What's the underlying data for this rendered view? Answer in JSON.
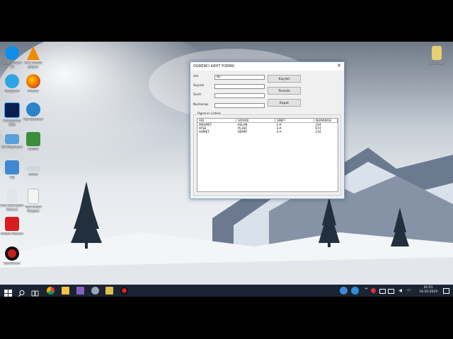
{
  "desktop_icons": [
    {
      "label": "TeamViewer 14",
      "icon": "teamviewer-icon",
      "color": "#0e8ee9"
    },
    {
      "label": "VLC media player",
      "icon": "vlc-icon",
      "color": "#f08a00"
    },
    {
      "label": "Telegram",
      "icon": "telegram-icon",
      "color": "#2ca5e0"
    },
    {
      "label": "Firefox",
      "icon": "firefox-icon",
      "color": "#e66000"
    },
    {
      "label": "Photoshop CS6",
      "icon": "photoshop-icon",
      "color": "#0c1e4d"
    },
    {
      "label": "HD Sentinel",
      "icon": "hd-sentinel-icon",
      "color": "#2a82c9"
    },
    {
      "label": "Bu bilgisayar",
      "icon": "computer-icon",
      "color": "#5aa0d8"
    },
    {
      "label": "Kodlar",
      "icon": "folder-icon",
      "color": "#3a8d3a"
    },
    {
      "label": "Ağ",
      "icon": "network-icon",
      "color": "#3f89d1"
    },
    {
      "label": "abcdl",
      "icon": "drive-icon",
      "color": "#cfd6de"
    },
    {
      "label": "Geri Dönüşüm Kutusu",
      "icon": "recycle-bin-icon",
      "color": "#dfe5ea"
    },
    {
      "label": "Yeni Metin Belgesi",
      "icon": "text-document-icon",
      "color": "#f4f4f4"
    },
    {
      "label": "Adobe Reader",
      "icon": "pdf-icon",
      "color": "#d71e1e"
    },
    {
      "label": "Bandicam",
      "icon": "bandicam-icon",
      "color": "#c91f1f"
    },
    {
      "label": "youtube",
      "icon": "youtube-folder-icon",
      "color": "#e8d070"
    }
  ],
  "dialog": {
    "title": "OGRENCI KAYIT FORMU",
    "close": "✕",
    "fields": [
      {
        "label": "Adı",
        "value": "Ali",
        "name": "name"
      },
      {
        "label": "Soyadı",
        "value": "",
        "name": "surname"
      },
      {
        "label": "Sınıfı",
        "value": "",
        "name": "class"
      },
      {
        "label": "Numarası",
        "value": "",
        "name": "number"
      }
    ],
    "buttons": {
      "save": "Kaydet",
      "clear": "Temizle",
      "close": "Kapat"
    },
    "group_label": "Ogrenci Listesi",
    "list": {
      "columns": [
        "ADI",
        "SOYADI",
        "SINIFI",
        "NUMARASI"
      ],
      "rows": [
        [
          "MEHMET",
          "ASLAN",
          "1-A",
          "234"
        ],
        [
          "AYŞE",
          "YILDIZ",
          "3-A",
          "674"
        ],
        [
          "AHMET",
          "DEMİR",
          "3-A",
          "234"
        ]
      ]
    }
  },
  "taskbar": {
    "time": "01:51",
    "date": "16.10.2019"
  },
  "colors": {
    "taskbar": "#1b2433",
    "dialog_border": "#7aa4d6"
  }
}
